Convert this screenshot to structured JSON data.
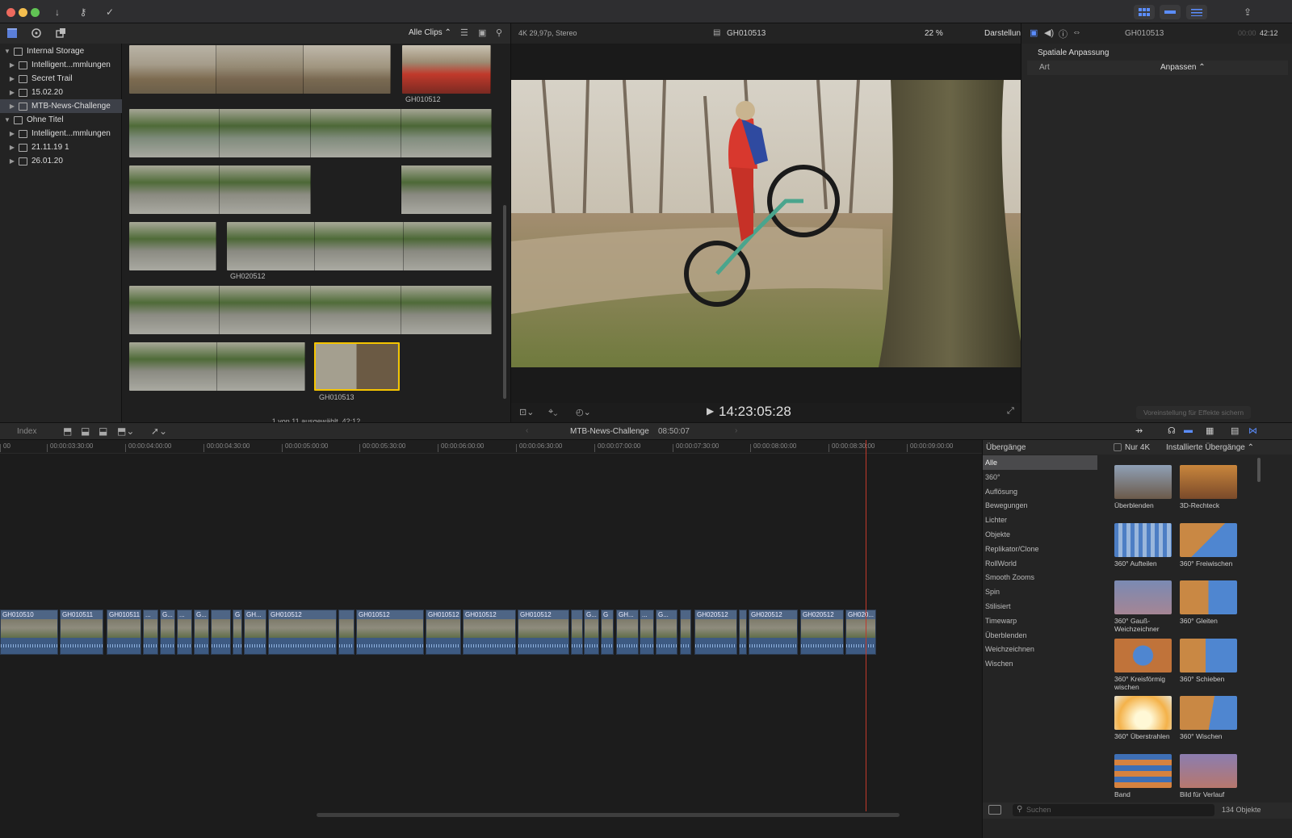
{
  "toolbar": {
    "share_icon": "share-icon"
  },
  "sidebar": {
    "items": [
      {
        "label": "Internal Storage",
        "level": 0,
        "expanded": true
      },
      {
        "label": "Intelligent...mmlungen",
        "level": 1
      },
      {
        "label": "Secret Trail",
        "level": 1
      },
      {
        "label": "15.02.20",
        "level": 1
      },
      {
        "label": "MTB-News-Challenge",
        "level": 1,
        "selected": true
      },
      {
        "label": "Ohne Titel",
        "level": 0,
        "expanded": true
      },
      {
        "label": "Intelligent...mmlungen",
        "level": 1
      },
      {
        "label": "21.11.19 1",
        "level": 1
      },
      {
        "label": "26.01.20",
        "level": 1
      }
    ]
  },
  "browser": {
    "filter_label": "Alle Clips ⌃",
    "clips": {
      "c2": "GH010512",
      "c4": "GH020512",
      "c6": "GH010513"
    },
    "footer": "1 von 11 ausgewählt, 42:12"
  },
  "viewer": {
    "format": "4K 29,97p, Stereo",
    "clip_name": "GH010513",
    "zoom": "22 %",
    "view_menu": "Darstellung",
    "timecode": "14:23:05:28"
  },
  "inspector": {
    "clip_name": "GH010513",
    "duration_dim": "00:00",
    "duration": "42:12",
    "section": "Spatiale Anpassung",
    "param_label": "Art",
    "param_value": "Anpassen ⌃",
    "save_preset": "Voreinstellung für Effekte sichern"
  },
  "timeline": {
    "index_label": "Index",
    "project": "MTB-News-Challenge",
    "duration": "08:50:07",
    "ruler": [
      "00",
      "00:00:03:30:00",
      "00:00:04:00:00",
      "00:00:04:30:00",
      "00:00:05:00:00",
      "00:00:05:30:00",
      "00:00:06:00:00",
      "00:00:06:30:00",
      "00:00:07:00:00",
      "00:00:07:30:00",
      "00:00:08:00:00",
      "00:00:08:30:00",
      "00:00:09:00:00"
    ],
    "clips": [
      "GH010510",
      "GH010511",
      "GH010511",
      "...",
      "G...",
      "...",
      "G...",
      "",
      "G",
      "GH...",
      "GH010512",
      "",
      "GH010512",
      "GH010512",
      "GH010512",
      "GH010512",
      "",
      "G...",
      "G",
      "GH...",
      "...",
      "G...",
      "",
      "GH020512",
      "",
      "GH020512",
      "GH020512",
      "GH020..."
    ]
  },
  "transitions": {
    "title": "Übergänge",
    "only4k": "Nur 4K",
    "installed": "Installierte Übergänge ⌃",
    "categories": [
      "Alle",
      "360°",
      "Auflösung",
      "Bewegungen",
      "Lichter",
      "Objekte",
      "Replikator/Clone",
      "RollWorld",
      "Smooth Zooms",
      "Spin",
      "Stilisiert",
      "Timewarp",
      "Überblenden",
      "Weichzeichnen",
      "Wischen"
    ],
    "items": [
      {
        "label": "Überblenden"
      },
      {
        "label": "3D-Rechteck"
      },
      {
        "label": "360° Aufteilen"
      },
      {
        "label": "360° Freiwischen"
      },
      {
        "label": "360° Gauß-Weichzeichner"
      },
      {
        "label": "360° Gleiten"
      },
      {
        "label": "360° Kreisförmig wischen"
      },
      {
        "label": "360° Schieben"
      },
      {
        "label": "360° Überstrahlen"
      },
      {
        "label": "360° Wischen"
      },
      {
        "label": "Band"
      },
      {
        "label": "Bild für Verlauf"
      }
    ],
    "search_placeholder": "Suchen",
    "count": "134 Objekte"
  }
}
